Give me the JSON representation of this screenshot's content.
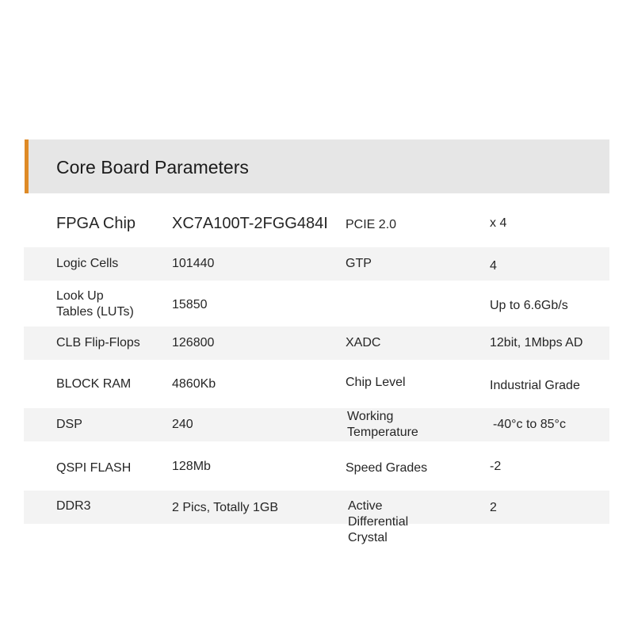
{
  "header": {
    "title": "Core Board Parameters",
    "accent_color": "#de8a26"
  },
  "rows": [
    {
      "label": "FPGA Chip",
      "value": "XC7A100T-2FGG484I",
      "label2": "PCIE 2.0",
      "value2": "x 4"
    },
    {
      "label": "Logic Cells",
      "value": "101440",
      "label2": "GTP",
      "value2": "4"
    },
    {
      "label": "Look Up\nTables (LUTs)",
      "value": "15850",
      "label2": "",
      "value2": "Up to 6.6Gb/s"
    },
    {
      "label": "CLB Flip-Flops",
      "value": "126800",
      "label2": "XADC",
      "value2": "12bit, 1Mbps AD"
    },
    {
      "label": "BLOCK RAM",
      "value": "4860Kb",
      "label2": "Chip Level",
      "value2": "Industrial Grade"
    },
    {
      "label": "DSP",
      "value": "240",
      "label2": "Working\nTemperature",
      "value2": "-40°c to 85°c"
    },
    {
      "label": "QSPI FLASH",
      "value": "128Mb",
      "label2": "Speed Grades",
      "value2": "-2"
    },
    {
      "label": "DDR3",
      "value": "2 Pics, Totally 1GB",
      "label2": "Active\nDifferential\nCrystal",
      "value2": "2"
    }
  ]
}
